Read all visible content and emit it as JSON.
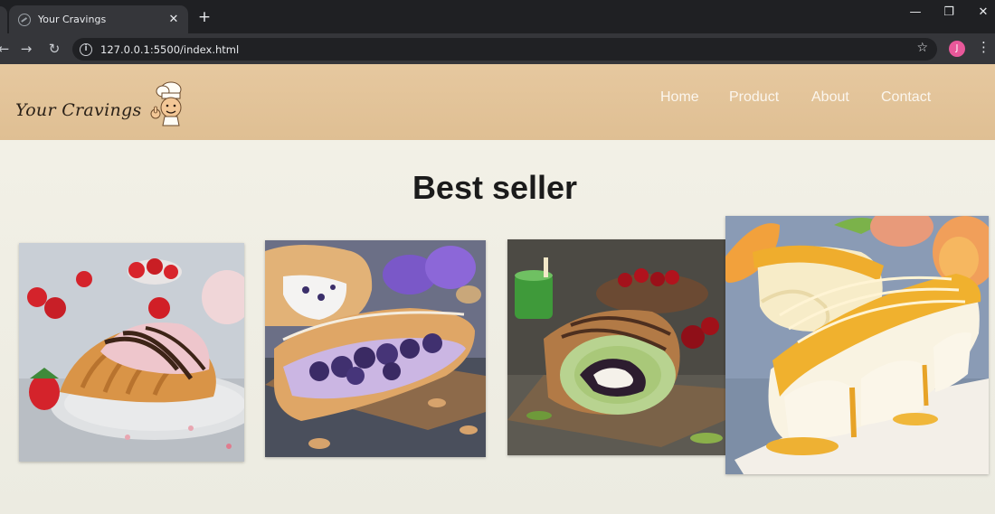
{
  "browser": {
    "tab_title": "Your Cravings",
    "tab_close_icon": "close-icon",
    "new_tab_icon": "plus-icon",
    "url": "127.0.0.1:5500/index.html",
    "profile_initial": "J",
    "window_controls": [
      "minimize-icon",
      "restore-icon",
      "close-icon"
    ]
  },
  "site": {
    "brand": "Your Cravings",
    "logo_icon": "chef-mascot-icon",
    "nav": [
      "Home",
      "Product",
      "About",
      "Contact"
    ],
    "header_color": "#e2c398",
    "nav_text_color": "#fbf6ee"
  },
  "section": {
    "title": "Best seller"
  },
  "products": [
    {
      "image": "croissant-strawberry-chocolate"
    },
    {
      "image": "blueberry-pastry"
    },
    {
      "image": "matcha-swiss-roll"
    },
    {
      "image": "mango-cheesecake-bar"
    }
  ]
}
